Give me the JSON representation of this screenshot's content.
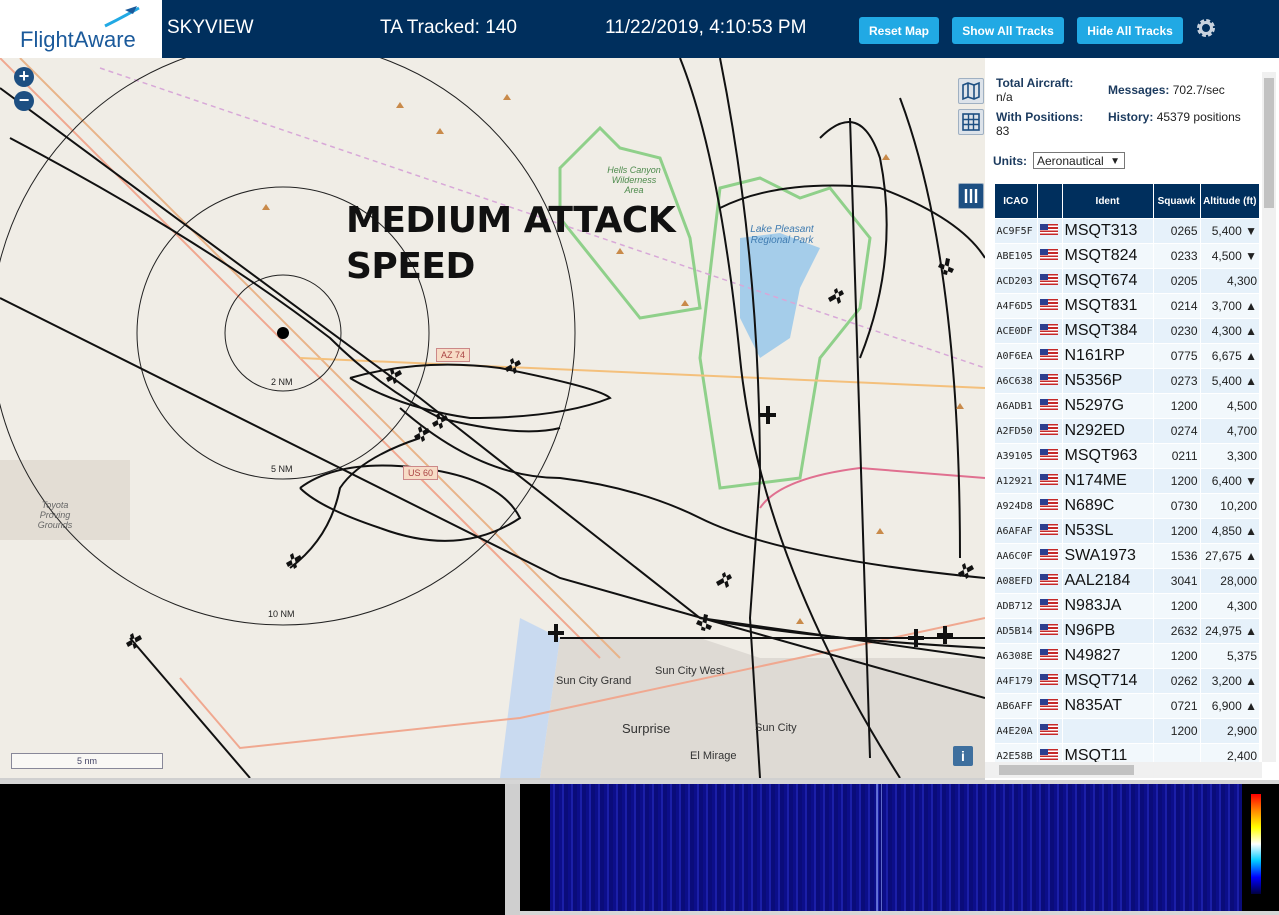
{
  "header": {
    "logo_text": "FlightAware",
    "app_name": "SKYVIEW",
    "tracked": "TA Tracked: 140",
    "datetime": "11/22/2019, 4:10:53 PM",
    "buttons": {
      "reset_map": "Reset Map",
      "show_all_tracks": "Show All Tracks",
      "hide_all_tracks": "Hide All Tracks"
    }
  },
  "map": {
    "overlay_text_line1": "MEDIUM ATTACK",
    "overlay_text_line2": "SPEED",
    "zoom_in": "+",
    "zoom_out": "−",
    "range_rings": [
      "2 NM",
      "5 NM",
      "10 NM"
    ],
    "scale_label": "5 nm",
    "info_label": "i",
    "labels": {
      "hells_canyon": "Hells Canyon Wilderness Area",
      "lake_pleasant": "Lake Pleasant Regional Park",
      "toyota": "Toyota Proving Grounds",
      "sun_city_grand": "Sun City Grand",
      "sun_city_west": "Sun City West",
      "surprise": "Surprise",
      "sun_city": "Sun City",
      "el_mirage": "El Mirage",
      "az74": "AZ 74",
      "us60": "US 60"
    }
  },
  "stats": {
    "total_aircraft_label": "Total Aircraft:",
    "total_aircraft_value": "n/a",
    "with_positions_label": "With Positions:",
    "with_positions_value": "83",
    "messages_label": "Messages:",
    "messages_value": "702.7/sec",
    "history_label": "History:",
    "history_value": "45379 positions",
    "units_label": "Units:",
    "units_value": "Aeronautical"
  },
  "table": {
    "headers": [
      "ICAO",
      "",
      "Ident",
      "Squawk",
      "Altitude (ft)"
    ],
    "rows": [
      {
        "icao": "AC9F5F",
        "ident": "MSQT313",
        "squawk": "0265",
        "alt": "5,400 ▼"
      },
      {
        "icao": "ABE105",
        "ident": "MSQT824",
        "squawk": "0233",
        "alt": "4,500 ▼"
      },
      {
        "icao": "ACD203",
        "ident": "MSQT674",
        "squawk": "0205",
        "alt": "4,300"
      },
      {
        "icao": "A4F6D5",
        "ident": "MSQT831",
        "squawk": "0214",
        "alt": "3,700 ▲"
      },
      {
        "icao": "ACE0DF",
        "ident": "MSQT384",
        "squawk": "0230",
        "alt": "4,300 ▲"
      },
      {
        "icao": "A0F6EA",
        "ident": "N161RP",
        "squawk": "0775",
        "alt": "6,675 ▲"
      },
      {
        "icao": "A6C638",
        "ident": "N5356P",
        "squawk": "0273",
        "alt": "5,400 ▲"
      },
      {
        "icao": "A6ADB1",
        "ident": "N5297G",
        "squawk": "1200",
        "alt": "4,500"
      },
      {
        "icao": "A2FD50",
        "ident": "N292ED",
        "squawk": "0274",
        "alt": "4,700"
      },
      {
        "icao": "A39105",
        "ident": "MSQT963",
        "squawk": "0211",
        "alt": "3,300"
      },
      {
        "icao": "A12921",
        "ident": "N174ME",
        "squawk": "1200",
        "alt": "6,400 ▼"
      },
      {
        "icao": "A924D8",
        "ident": "N689C",
        "squawk": "0730",
        "alt": "10,200"
      },
      {
        "icao": "A6AFAF",
        "ident": "N53SL",
        "squawk": "1200",
        "alt": "4,850 ▲"
      },
      {
        "icao": "AA6C0F",
        "ident": "SWA1973",
        "squawk": "1536",
        "alt": "27,675 ▲"
      },
      {
        "icao": "A08EFD",
        "ident": "AAL2184",
        "squawk": "3041",
        "alt": "28,000"
      },
      {
        "icao": "ADB712",
        "ident": "N983JA",
        "squawk": "1200",
        "alt": "4,300"
      },
      {
        "icao": "AD5B14",
        "ident": "N96PB",
        "squawk": "2632",
        "alt": "24,975 ▲"
      },
      {
        "icao": "A6308E",
        "ident": "N49827",
        "squawk": "1200",
        "alt": "5,375"
      },
      {
        "icao": "A4F179",
        "ident": "MSQT714",
        "squawk": "0262",
        "alt": "3,200 ▲"
      },
      {
        "icao": "AB6AFF",
        "ident": "N835AT",
        "squawk": "0721",
        "alt": "6,900 ▲"
      },
      {
        "icao": "A4E20A",
        "ident": "",
        "squawk": "1200",
        "alt": "2,900"
      },
      {
        "icao": "A2E58B",
        "ident": "MSQT11",
        "squawk": "",
        "alt": "2,400"
      }
    ]
  },
  "colors": {
    "header_bg": "#002f5d",
    "button_bg": "#21a9e4",
    "track": "#111111",
    "map_bg": "#f0ede6"
  }
}
